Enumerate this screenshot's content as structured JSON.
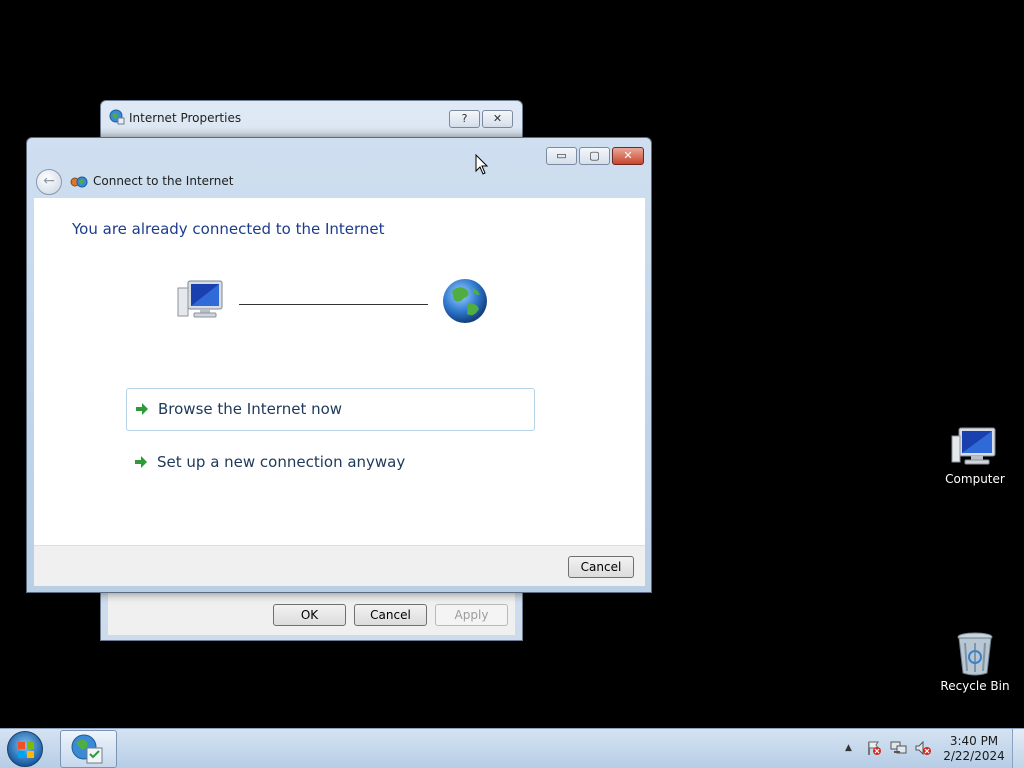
{
  "desktop": {
    "icons": [
      {
        "label": "Computer"
      },
      {
        "label": "Recycle Bin"
      }
    ]
  },
  "internet_properties": {
    "title": "Internet Properties",
    "help_glyph": "?",
    "close_glyph": "✕",
    "buttons": {
      "ok": "OK",
      "cancel": "Cancel",
      "apply": "Apply"
    }
  },
  "wizard": {
    "title": "Connect to the Internet",
    "heading": "You are already connected to the Internet",
    "options": [
      {
        "label": "Browse the Internet now"
      },
      {
        "label": "Set up a new connection anyway"
      }
    ],
    "cancel": "Cancel",
    "minimize_glyph": "▭",
    "maximize_glyph": "▢",
    "close_glyph": "✕",
    "back_glyph": "←"
  },
  "taskbar": {
    "time": "3:40 PM",
    "date": "2/22/2024",
    "tray_arrow": "▲"
  },
  "colors": {
    "heading": "#1c3d8c",
    "link_text": "#1e395b",
    "arrow_green": "#2e9b3a",
    "close_red": "#c8452c"
  }
}
